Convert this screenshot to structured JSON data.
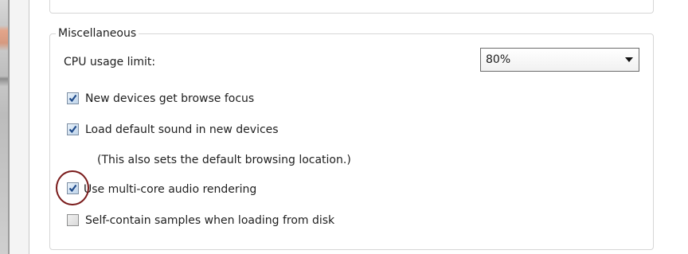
{
  "misc": {
    "group_title": "Miscellaneous",
    "cpu_label": "CPU usage limit:",
    "cpu_value": "80%",
    "options": [
      {
        "label": "New devices get browse focus",
        "checked": true
      },
      {
        "label": "Load default sound in new devices",
        "checked": true
      },
      {
        "label": "Use multi-core audio rendering",
        "checked": true
      },
      {
        "label": "Self-contain samples when loading from disk",
        "checked": false
      }
    ],
    "note": "(This also sets the default browsing location.)"
  },
  "colors": {
    "highlight_ring": "#7a1b1b",
    "check_mark": "#1f4a8a"
  }
}
